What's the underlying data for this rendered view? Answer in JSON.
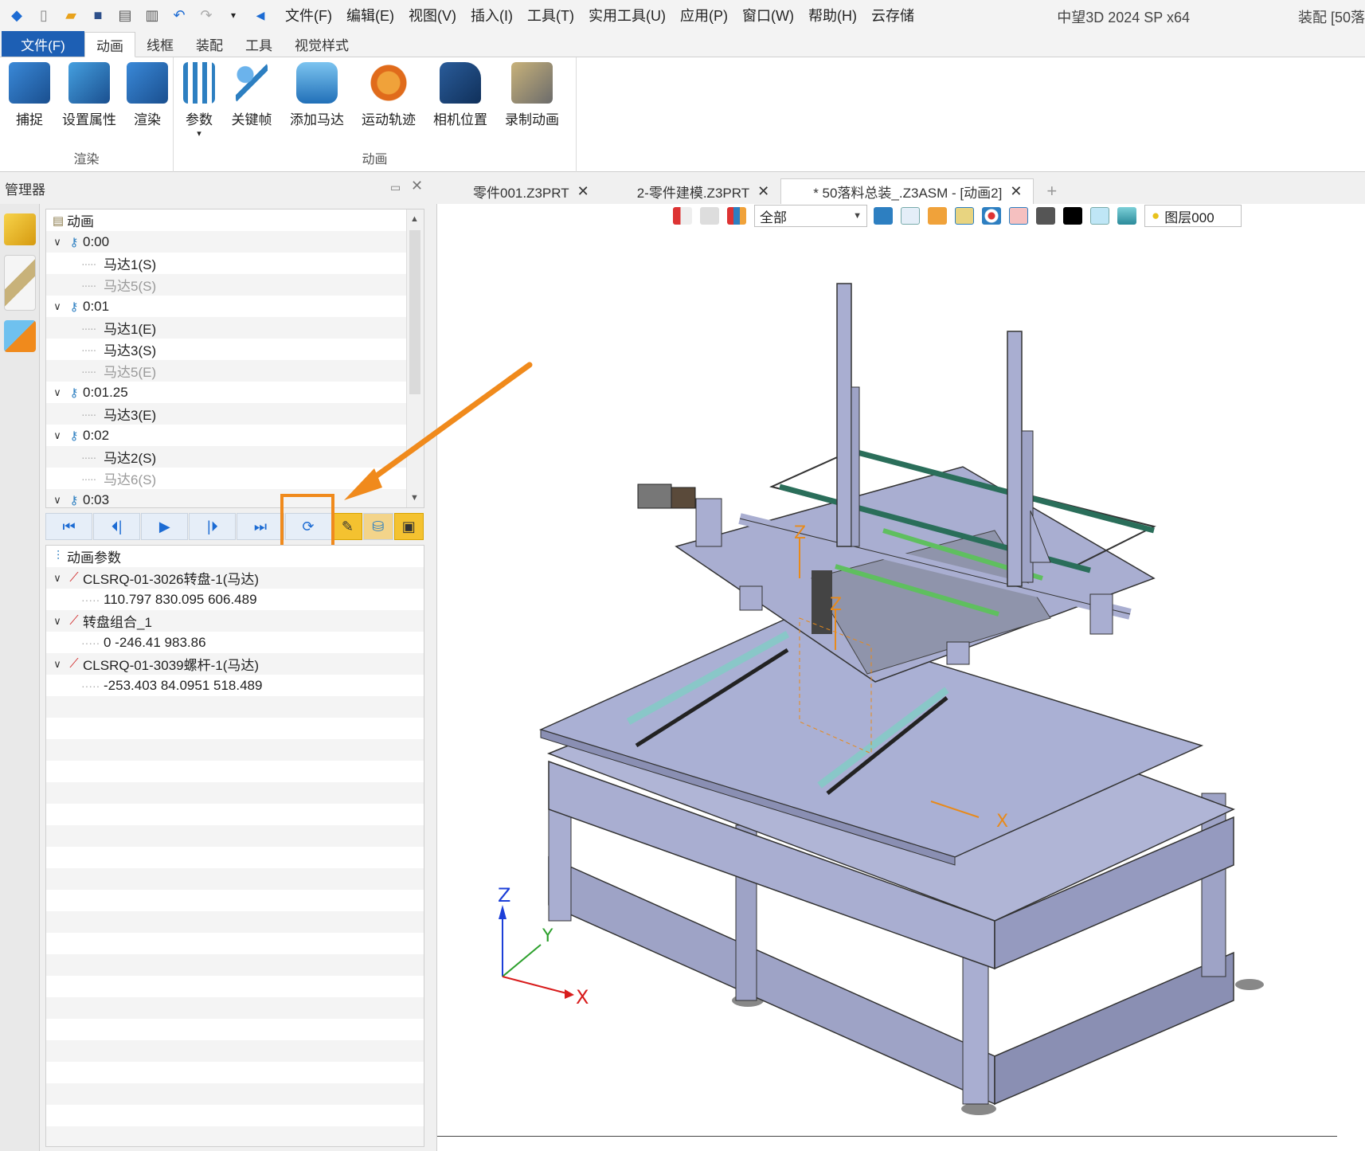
{
  "titlebar": {
    "menus": [
      "文件(F)",
      "编辑(E)",
      "视图(V)",
      "插入(I)",
      "工具(T)",
      "实用工具(U)",
      "应用(P)",
      "窗口(W)",
      "帮助(H)",
      "云存储"
    ],
    "app_title": "中望3D 2024 SP x64",
    "doc_mode": "装配 [50落"
  },
  "ribbon": {
    "file_tab": "文件(F)",
    "tabs": [
      "动画",
      "线框",
      "装配",
      "工具",
      "视觉样式"
    ],
    "active_tab": "动画",
    "groups": [
      {
        "label": "渲染",
        "buttons": [
          "捕捉",
          "设置属性",
          "渲染"
        ]
      },
      {
        "label": "动画",
        "buttons": [
          "参数",
          "关键帧",
          "添加马达",
          "运动轨迹",
          "相机位置",
          "录制动画"
        ]
      }
    ]
  },
  "manager": {
    "title": "管理器",
    "tree_root": "动画",
    "keyframes": [
      {
        "time": "0:00",
        "items": [
          {
            "label": "马达1(S)",
            "dim": false
          },
          {
            "label": "马达5(S)",
            "dim": true
          }
        ]
      },
      {
        "time": "0:01",
        "items": [
          {
            "label": "马达1(E)",
            "dim": false
          },
          {
            "label": "马达3(S)",
            "dim": false
          },
          {
            "label": "马达5(E)",
            "dim": true
          }
        ]
      },
      {
        "time": "0:01.25",
        "items": [
          {
            "label": "马达3(E)",
            "dim": false
          }
        ]
      },
      {
        "time": "0:02",
        "items": [
          {
            "label": "马达2(S)",
            "dim": false
          },
          {
            "label": "马达6(S)",
            "dim": true
          }
        ]
      },
      {
        "time": "0:03",
        "items": []
      }
    ],
    "params_title": "动画参数",
    "params": [
      {
        "name": "CLSRQ-01-3026转盘-1(马达)",
        "value": "110.797 830.095 606.489"
      },
      {
        "name": "转盘组合_1",
        "value": "0 -246.41 983.86"
      },
      {
        "name": "CLSRQ-01-3039螺杆-1(马达)",
        "value": "-253.403 84.0951 518.489"
      }
    ]
  },
  "doc_tabs": [
    {
      "label": "零件001.Z3PRT",
      "active": false
    },
    {
      "label": "2-零件建模.Z3PRT",
      "active": false
    },
    {
      "label": "* 50落料总装_.Z3ASM - [动画2]",
      "active": true
    }
  ],
  "viewport": {
    "filter_value": "全部",
    "layer_label": "图层000",
    "axes": {
      "x": "X",
      "y": "Y",
      "z": "Z"
    }
  },
  "colors": {
    "file_tab": "#1d5fb4",
    "highlight": "#f08a1c",
    "model_body": "#a9aed1"
  }
}
